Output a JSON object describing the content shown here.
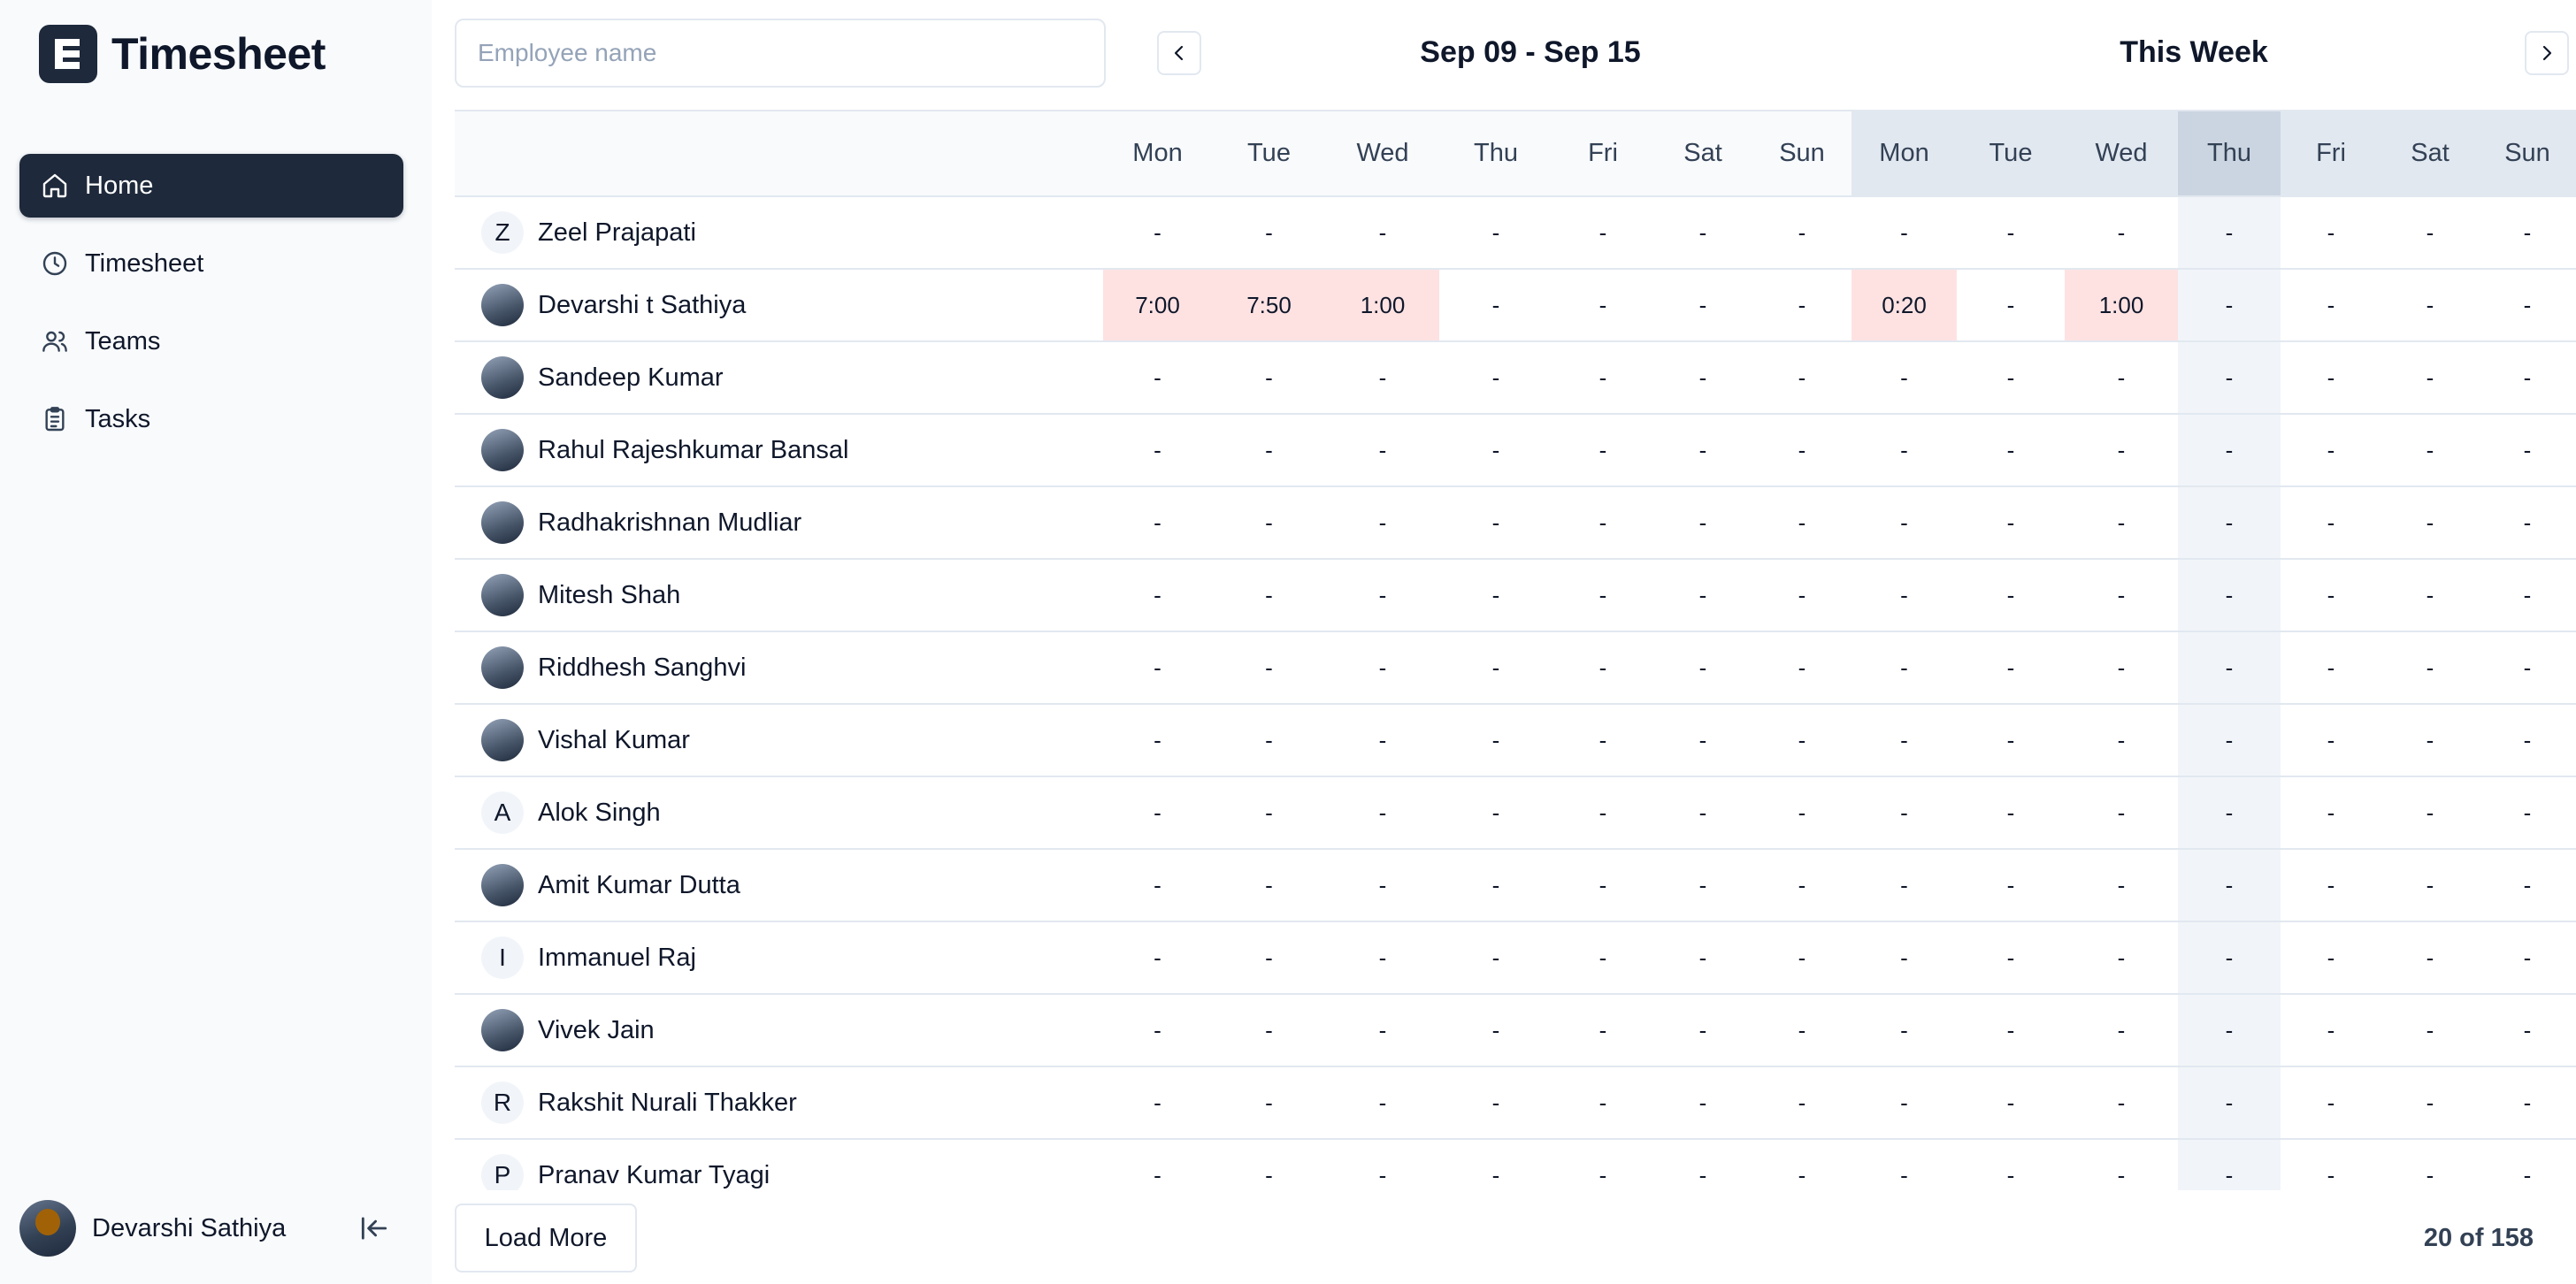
{
  "app": {
    "title": "Timesheet",
    "logo_letter": "E"
  },
  "sidebar": {
    "items": [
      {
        "label": "Home",
        "icon": "home-icon",
        "active": true
      },
      {
        "label": "Timesheet",
        "icon": "clock-icon",
        "active": false
      },
      {
        "label": "Teams",
        "icon": "users-icon",
        "active": false
      },
      {
        "label": "Tasks",
        "icon": "clipboard-icon",
        "active": false
      }
    ],
    "user": {
      "name": "Devarshi Sathiya"
    }
  },
  "search": {
    "placeholder": "Employee name",
    "value": ""
  },
  "header": {
    "range": "Sep 09 - Sep 15",
    "current_week": "This Week"
  },
  "table": {
    "days": [
      "Mon",
      "Tue",
      "Wed",
      "Thu",
      "Fri",
      "Sat",
      "Sun",
      "Mon",
      "Tue",
      "Wed",
      "Thu",
      "Fri",
      "Sat",
      "Sun"
    ],
    "today_index": 10,
    "rows": [
      {
        "name": "Zeel Prajapati",
        "initial": "Z",
        "photo": false,
        "values": [
          "-",
          "-",
          "-",
          "-",
          "-",
          "-",
          "-",
          "-",
          "-",
          "-",
          "-",
          "-",
          "-",
          "-"
        ]
      },
      {
        "name": "Devarshi t Sathiya",
        "initial": "",
        "photo": true,
        "values": [
          "7:00",
          "7:50",
          "1:00",
          "-",
          "-",
          "-",
          "-",
          "0:20",
          "-",
          "1:00",
          "-",
          "-",
          "-",
          "-"
        ]
      },
      {
        "name": "Sandeep Kumar",
        "initial": "",
        "photo": true,
        "values": [
          "-",
          "-",
          "-",
          "-",
          "-",
          "-",
          "-",
          "-",
          "-",
          "-",
          "-",
          "-",
          "-",
          "-"
        ]
      },
      {
        "name": "Rahul Rajeshkumar Bansal",
        "initial": "",
        "photo": true,
        "values": [
          "-",
          "-",
          "-",
          "-",
          "-",
          "-",
          "-",
          "-",
          "-",
          "-",
          "-",
          "-",
          "-",
          "-"
        ]
      },
      {
        "name": "Radhakrishnan Mudliar",
        "initial": "",
        "photo": true,
        "values": [
          "-",
          "-",
          "-",
          "-",
          "-",
          "-",
          "-",
          "-",
          "-",
          "-",
          "-",
          "-",
          "-",
          "-"
        ]
      },
      {
        "name": "Mitesh Shah",
        "initial": "",
        "photo": true,
        "values": [
          "-",
          "-",
          "-",
          "-",
          "-",
          "-",
          "-",
          "-",
          "-",
          "-",
          "-",
          "-",
          "-",
          "-"
        ]
      },
      {
        "name": "Riddhesh Sanghvi",
        "initial": "",
        "photo": true,
        "values": [
          "-",
          "-",
          "-",
          "-",
          "-",
          "-",
          "-",
          "-",
          "-",
          "-",
          "-",
          "-",
          "-",
          "-"
        ]
      },
      {
        "name": "Vishal Kumar",
        "initial": "",
        "photo": true,
        "values": [
          "-",
          "-",
          "-",
          "-",
          "-",
          "-",
          "-",
          "-",
          "-",
          "-",
          "-",
          "-",
          "-",
          "-"
        ]
      },
      {
        "name": "Alok Singh",
        "initial": "A",
        "photo": false,
        "values": [
          "-",
          "-",
          "-",
          "-",
          "-",
          "-",
          "-",
          "-",
          "-",
          "-",
          "-",
          "-",
          "-",
          "-"
        ]
      },
      {
        "name": "Amit Kumar Dutta",
        "initial": "",
        "photo": true,
        "values": [
          "-",
          "-",
          "-",
          "-",
          "-",
          "-",
          "-",
          "-",
          "-",
          "-",
          "-",
          "-",
          "-",
          "-"
        ]
      },
      {
        "name": "Immanuel Raj",
        "initial": "I",
        "photo": false,
        "values": [
          "-",
          "-",
          "-",
          "-",
          "-",
          "-",
          "-",
          "-",
          "-",
          "-",
          "-",
          "-",
          "-",
          "-"
        ]
      },
      {
        "name": "Vivek Jain",
        "initial": "",
        "photo": true,
        "values": [
          "-",
          "-",
          "-",
          "-",
          "-",
          "-",
          "-",
          "-",
          "-",
          "-",
          "-",
          "-",
          "-",
          "-"
        ]
      },
      {
        "name": "Rakshit Nurali Thakker",
        "initial": "R",
        "photo": false,
        "values": [
          "-",
          "-",
          "-",
          "-",
          "-",
          "-",
          "-",
          "-",
          "-",
          "-",
          "-",
          "-",
          "-",
          "-"
        ]
      },
      {
        "name": "Pranav Kumar Tyagi",
        "initial": "P",
        "photo": false,
        "values": [
          "-",
          "-",
          "-",
          "-",
          "-",
          "-",
          "-",
          "-",
          "-",
          "-",
          "-",
          "-",
          "-",
          "-"
        ]
      }
    ]
  },
  "footer": {
    "load_more": "Load More",
    "count": "20 of 158"
  }
}
